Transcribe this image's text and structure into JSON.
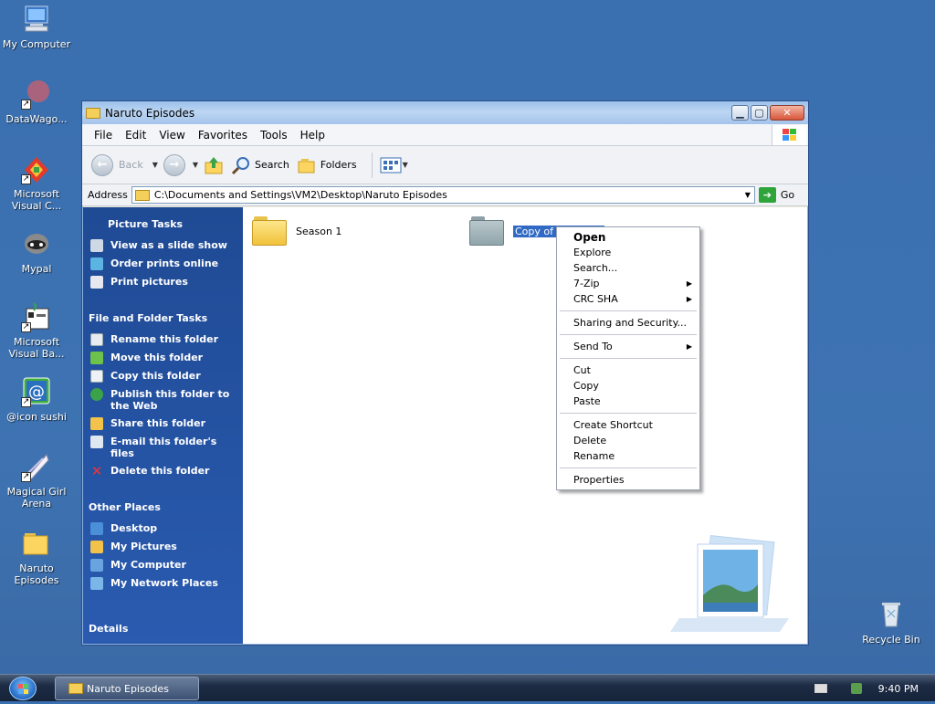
{
  "desktop": {
    "icons": [
      {
        "label": "My Computer",
        "icon": "computer-icon"
      },
      {
        "label": "DataWago...",
        "icon": "datawagon-icon"
      },
      {
        "label": "Microsoft Visual C...",
        "icon": "visual-c-icon"
      },
      {
        "label": "Mypal",
        "icon": "mypal-icon"
      },
      {
        "label": "Microsoft Visual Ba...",
        "icon": "visual-basic-icon"
      },
      {
        "label": "@icon sushi",
        "icon": "icon-sushi-icon"
      },
      {
        "label": "Magical Girl Arena",
        "icon": "magical-girl-arena-icon"
      },
      {
        "label": "Naruto Episodes",
        "icon": "folder-icon"
      },
      {
        "label": "Recycle Bin",
        "icon": "recycle-bin-icon"
      }
    ]
  },
  "window": {
    "title": "Naruto Episodes",
    "menu": [
      "File",
      "Edit",
      "View",
      "Favorites",
      "Tools",
      "Help"
    ],
    "toolbar": {
      "back": "Back",
      "search": "Search",
      "folders": "Folders"
    },
    "address": {
      "label": "Address",
      "value": "C:\\Documents and Settings\\VM2\\Desktop\\Naruto Episodes",
      "go": "Go"
    },
    "sidebar": {
      "picture_tasks": {
        "title": "Picture Tasks",
        "items": [
          "View as a slide show",
          "Order prints online",
          "Print pictures"
        ]
      },
      "file_folder_tasks": {
        "title": "File and Folder Tasks",
        "items": [
          "Rename this folder",
          "Move this folder",
          "Copy this folder",
          "Publish this folder to the Web",
          "Share this folder",
          "E-mail this folder's files",
          "Delete this folder"
        ]
      },
      "other_places": {
        "title": "Other Places",
        "items": [
          "Desktop",
          "My Pictures",
          "My Computer",
          "My Network Places"
        ]
      },
      "details": "Details"
    },
    "files": [
      {
        "name": "Season 1",
        "selected": false
      },
      {
        "name": "Copy of Season 1",
        "selected": true
      }
    ]
  },
  "context_menu": {
    "items": [
      {
        "label": "Open",
        "bold": true
      },
      {
        "label": "Explore"
      },
      {
        "label": "Search..."
      },
      {
        "label": "7-Zip",
        "submenu": true
      },
      {
        "label": "CRC SHA",
        "submenu": true
      },
      {
        "sep": true
      },
      {
        "label": "Sharing and Security..."
      },
      {
        "sep": true
      },
      {
        "label": "Send To",
        "submenu": true
      },
      {
        "sep": true
      },
      {
        "label": "Cut"
      },
      {
        "label": "Copy"
      },
      {
        "label": "Paste"
      },
      {
        "sep": true
      },
      {
        "label": "Create Shortcut"
      },
      {
        "label": "Delete"
      },
      {
        "label": "Rename"
      },
      {
        "sep": true
      },
      {
        "label": "Properties"
      }
    ]
  },
  "taskbar": {
    "task": "Naruto Episodes",
    "clock": "9:40 PM"
  },
  "colors": {
    "desktop": "#3a6fb0",
    "sidebar": "#1f4a94",
    "selection": "#316ac5"
  }
}
